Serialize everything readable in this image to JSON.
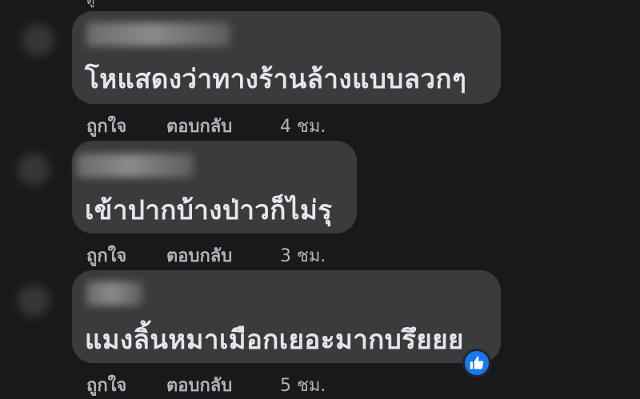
{
  "top_fragment": "ดู",
  "comments": [
    {
      "text": "โหแสดงว่าทางร้านล้างแบบลวกๆ",
      "like_label": "ถูกใจ",
      "reply_label": "ตอบกลับ",
      "time": "4 ชม."
    },
    {
      "text": "เข้าปากบ้างป่าวก็ไม่รุ",
      "like_label": "ถูกใจ",
      "reply_label": "ตอบกลับ",
      "time": "3 ชม."
    },
    {
      "text": "แมงลิ้นหมาเมือกเยอะมากบรึยยย",
      "like_label": "ถูกใจ",
      "reply_label": "ตอบกลับ",
      "time": "5 ชม."
    }
  ],
  "reaction_icon": "thumbs-up-icon",
  "colors": {
    "background": "#18191a",
    "bubble": "#3a3b3c",
    "text": "#e4e6eb",
    "secondary_text": "#b0b3b8",
    "like_blue": "#1877f2"
  }
}
